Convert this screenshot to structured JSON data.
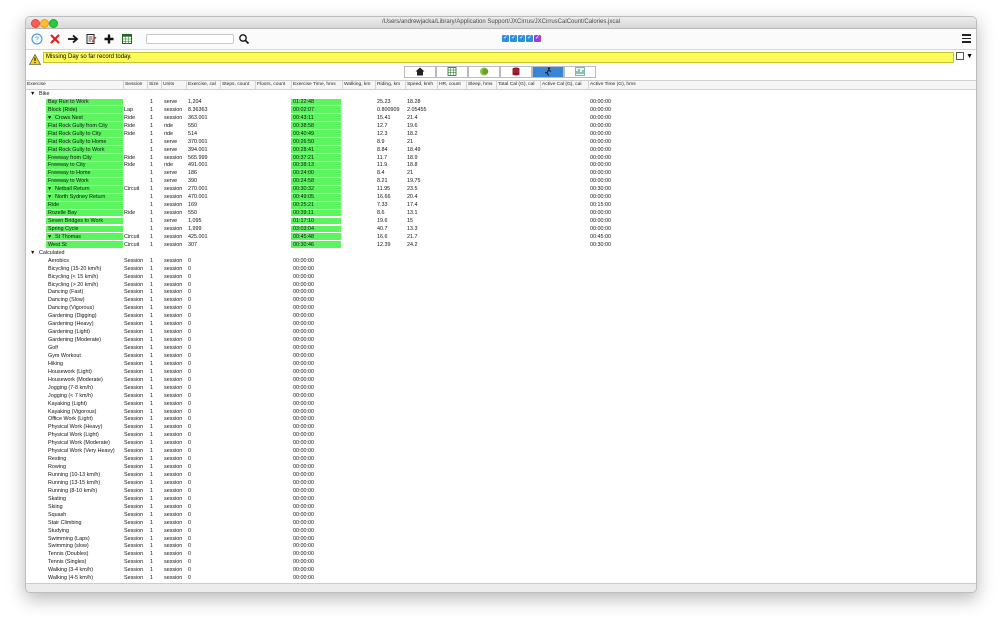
{
  "window": {
    "title": "/Users/andrewjacka/Library/Application Support/JXCirrus/JXCirrusCalCount/Calories.jxcal"
  },
  "toolbar": {
    "help_icon": "question-circle-icon",
    "delete_icon": "red-x-icon",
    "forward_icon": "arrow-right-icon",
    "edit_icon": "clipboard-edit-icon",
    "add_icon": "plus-icon",
    "calendar_icon": "calendar-icon",
    "search_value": "",
    "search_icon": "magnifier-icon",
    "menu_icon": "hamburger-icon"
  },
  "message": {
    "text": "Missing Day so far record today."
  },
  "columns": [
    "Exercise",
    "Session",
    "Size",
    "Units",
    "Exercise, cal",
    "Steps, count",
    "Floors, count",
    "Exercise Time, hms",
    "Walking, km",
    "Riding, km",
    "Speed, kmh",
    "HR, count",
    "Sleep, hms",
    "Total Cal (G), cal",
    "Active Cal (G), cal",
    "Active Time (G), hms"
  ],
  "groups": {
    "bike": "Bike",
    "calculated": "Calculated"
  },
  "bike_rows": [
    {
      "name": "Bay Run to Work",
      "session": "",
      "size": "1",
      "units": "serve",
      "cal": "1,204",
      "time": "01:22:48",
      "riding": "25.23",
      "speed": "18.28",
      "active": "00:00:00",
      "heart": false
    },
    {
      "name": "Block (Ride)",
      "session": "Lap",
      "size": "1",
      "units": "session",
      "cal": "8.36363",
      "time": "00:02:07",
      "riding": "0.800909",
      "speed": "2.05455",
      "active": "00:00:00",
      "heart": false
    },
    {
      "name": "Crows Nest",
      "session": "Ride",
      "size": "1",
      "units": "session",
      "cal": "363.001",
      "time": "00:43:11",
      "riding": "15.41",
      "speed": "21.4",
      "active": "00:00:00",
      "heart": true
    },
    {
      "name": "Flat Rock Gully from City",
      "session": "Ride",
      "size": "1",
      "units": "ride",
      "cal": "550",
      "time": "00:38:58",
      "riding": "12.7",
      "speed": "19.6",
      "active": "00:00:00",
      "heart": false
    },
    {
      "name": "Flat Rock Gully to City",
      "session": "Ride",
      "size": "1",
      "units": "ride",
      "cal": "514",
      "time": "00:40:49",
      "riding": "12.3",
      "speed": "18.2",
      "active": "00:00:00",
      "heart": false
    },
    {
      "name": "Flat Rock Gully to Home",
      "session": "",
      "size": "1",
      "units": "serve",
      "cal": "370.001",
      "time": "00:26:50",
      "riding": "8.9",
      "speed": "21",
      "active": "00:00:00",
      "heart": false
    },
    {
      "name": "Flat Rock Gully to Work",
      "session": "",
      "size": "1",
      "units": "serve",
      "cal": "394.001",
      "time": "00:28:41",
      "riding": "8.84",
      "speed": "18.49",
      "active": "00:00:00",
      "heart": false
    },
    {
      "name": "Freeway from City",
      "session": "Ride",
      "size": "1",
      "units": "session",
      "cal": "565.999",
      "time": "00:37:21",
      "riding": "11.7",
      "speed": "18.9",
      "active": "00:00:00",
      "heart": false
    },
    {
      "name": "Freeway to City",
      "session": "Ride",
      "size": "1",
      "units": "ride",
      "cal": "491.001",
      "time": "00:38:13",
      "riding": "11.9",
      "speed": "18.8",
      "active": "00:00:00",
      "heart": false
    },
    {
      "name": "Freeway to Home",
      "session": "",
      "size": "1",
      "units": "serve",
      "cal": "186",
      "time": "00:24:00",
      "riding": "8.4",
      "speed": "21",
      "active": "00:00:00",
      "heart": false
    },
    {
      "name": "Freeway to Work",
      "session": "",
      "size": "1",
      "units": "serve",
      "cal": "390",
      "time": "00:24:58",
      "riding": "8.21",
      "speed": "19.75",
      "active": "00:00:00",
      "heart": false
    },
    {
      "name": "Netball Return",
      "session": "Circuit",
      "size": "1",
      "units": "session",
      "cal": "270.001",
      "time": "00:30:32",
      "riding": "11.95",
      "speed": "23.5",
      "active": "00:30:00",
      "heart": true
    },
    {
      "name": "North Sydney Return",
      "session": "",
      "size": "1",
      "units": "session",
      "cal": "470.001",
      "time": "00:49:05",
      "riding": "16.66",
      "speed": "20.4",
      "active": "00:00:00",
      "heart": true
    },
    {
      "name": "Ride",
      "session": "",
      "size": "1",
      "units": "session",
      "cal": "169",
      "time": "00:25:21",
      "riding": "7.33",
      "speed": "17.4",
      "active": "00:15:00",
      "heart": false
    },
    {
      "name": "Rozelle Bay",
      "session": "Ride",
      "size": "1",
      "units": "session",
      "cal": "550",
      "time": "00:39:11",
      "riding": "8.6",
      "speed": "13.1",
      "active": "00:00:00",
      "heart": false
    },
    {
      "name": "Seven Bridges to Work",
      "session": "",
      "size": "1",
      "units": "serve",
      "cal": "1,095",
      "time": "01:17:10",
      "riding": "19.6",
      "speed": "15",
      "active": "00:00:00",
      "heart": false
    },
    {
      "name": "Spring Cycle",
      "session": "",
      "size": "1",
      "units": "session",
      "cal": "1,999",
      "time": "03:03:04",
      "riding": "40.7",
      "speed": "13.3",
      "active": "00:00:00",
      "heart": false
    },
    {
      "name": "St Thomas",
      "session": "Circuit",
      "size": "1",
      "units": "session",
      "cal": "425.001",
      "time": "00:45:48",
      "riding": "16.6",
      "speed": "21.7",
      "active": "00:45:00",
      "heart": true
    },
    {
      "name": "West St",
      "session": "Circuit",
      "size": "1",
      "units": "session",
      "cal": "307",
      "time": "00:30:46",
      "riding": "12.39",
      "speed": "24.2",
      "active": "00:30:00",
      "heart": false
    }
  ],
  "calc_rows": [
    "Aerobics",
    "Bicycling (15-20 km/h)",
    "Bicycling (< 15 km/h)",
    "Bicycling (> 20 km/h)",
    "Dancing (Fast)",
    "Dancing (Slow)",
    "Dancing (Vigorous)",
    "Gardening (Digging)",
    "Gardening (Heavy)",
    "Gardening (Light)",
    "Gardening (Moderate)",
    "Golf",
    "Gym Workout",
    "Hiking",
    "Housework (Light)",
    "Housework (Moderate)",
    "Jogging (7-8 km/h)",
    "Jogging (< 7 km/h)",
    "Kayaking (Light)",
    "Kayaking (Vigorous)",
    "Office Work (Light)",
    "Physical Work (Heavy)",
    "Physical Work (Light)",
    "Physical Work (Moderate)",
    "Physical Work (Very Heavy)",
    "Resting",
    "Rowing",
    "Running (10-13 km/h)",
    "Running (13-15 km/h)",
    "Running (8-10 km/h)",
    "Skating",
    "Skiing",
    "Squash",
    "Stair Climbing",
    "Studying",
    "Swimming (Laps)",
    "Swimming (slow)",
    "Tennis (Doubles)",
    "Tennis (Singles)",
    "Walking (3-4 km/h)",
    "Walking (4-5 km/h)"
  ],
  "calc_defaults": {
    "session": "Session",
    "size": "1",
    "units": "session",
    "cal": "0",
    "time": "00:00:00"
  },
  "colors": {
    "highlight": "#5cf45f",
    "message_bg": "#fdfb59"
  }
}
